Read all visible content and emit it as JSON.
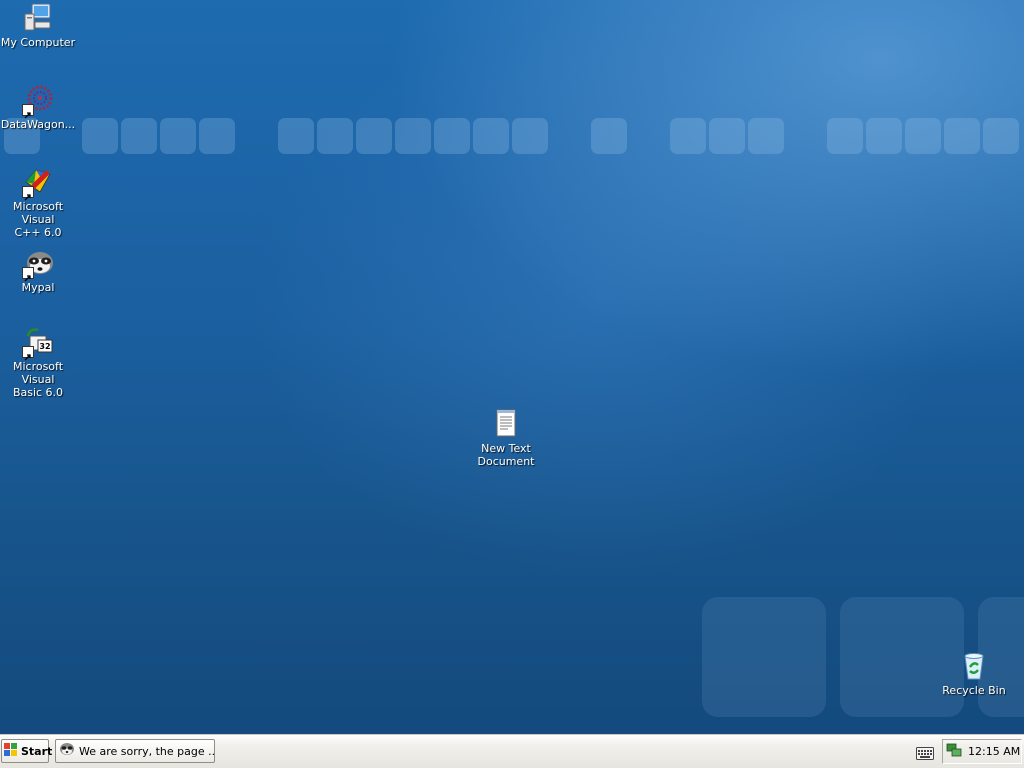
{
  "desktop": {
    "icons": [
      {
        "label": "My Computer",
        "icon": "my-computer-icon"
      },
      {
        "label": "DataWagon...",
        "icon": "datawagon-icon"
      },
      {
        "label": "Microsoft Visual\nC++ 6.0",
        "icon": "visual-cpp-icon"
      },
      {
        "label": "Mypal",
        "icon": "mypal-icon"
      },
      {
        "label": "Microsoft Visual\nBasic 6.0",
        "icon": "visual-basic-icon"
      },
      {
        "label": "New Text\nDocument",
        "icon": "text-document-icon"
      },
      {
        "label": "Recycle Bin",
        "icon": "recycle-bin-icon"
      }
    ]
  },
  "taskbar": {
    "start_label": "Start",
    "task_label": "We are sorry, the page ...",
    "clock": "12:15 AM"
  },
  "colors": {
    "desktop_top": "#1e6bb0",
    "desktop_bottom": "#144a7d",
    "taskbar": "#ece9d8"
  }
}
